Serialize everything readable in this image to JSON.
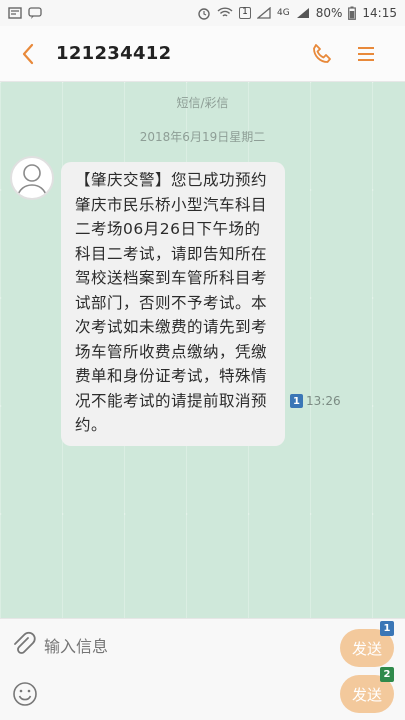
{
  "status_bar": {
    "sim1_label": "1",
    "network": "4G",
    "battery": "80%",
    "time": "14:15"
  },
  "header": {
    "title": "121234412",
    "icons": [
      "back-icon",
      "phone-icon",
      "menu-icon"
    ]
  },
  "thread": {
    "message_type": "短信/彩信",
    "date": "2018年6月19日星期二",
    "message": {
      "text": "【肇庆交警】您已成功预约肇庆市民乐桥小型汽车科目二考场06月26日下午场的科目二考试，请即告知所在驾校送档案到车管所科目考试部门，否则不予考试。本次考试如未缴费的请先到考场车管所收费点缴纳，凭缴费单和身份证考试，特殊情况不能考试的请提前取消预约。",
      "sim": "1",
      "time": "13:26"
    }
  },
  "composer": {
    "placeholder": "输入信息",
    "send1": {
      "label": "发送",
      "sim": "1"
    },
    "send2": {
      "label": "发送",
      "sim": "2"
    }
  },
  "colors": {
    "accent": "#e8893a",
    "chat_bg": "#cfe8da",
    "bubble_bg": "#f1f1f1",
    "sim1": "#3a76b6",
    "sim2": "#2f8a4b",
    "send_bg": "#f3c99c"
  }
}
